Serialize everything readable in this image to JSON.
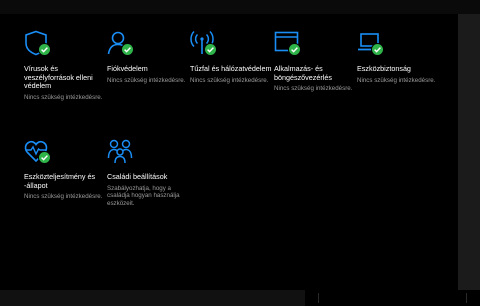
{
  "tiles": [
    {
      "title": "Vírusok és veszélyforrások elleni védelem",
      "status": "Nincs szükség intézkedésre.",
      "icon": "shield-icon"
    },
    {
      "title": "Fiókvédelem",
      "status": "Nincs szükség intézkedésre.",
      "icon": "person-icon"
    },
    {
      "title": "Tűzfal és hálózatvédelem",
      "status": "Nincs szükség intézkedésre.",
      "icon": "antenna-icon"
    },
    {
      "title": "Alkalmazás- és böngészővezérlés",
      "status": "Nincs szükség intézkedésre.",
      "icon": "browser-window-icon"
    },
    {
      "title": "Eszközbiztonság",
      "status": "Nincs szükség intézkedésre.",
      "icon": "laptop-icon"
    },
    {
      "title": "Eszközteljesítmény és -állapot",
      "status": "Nincs szükség intézkedésre.",
      "icon": "heart-pulse-icon"
    },
    {
      "title": "Családi beállítások",
      "status": "Szabályozhatja, hogy a családja hogyan használja eszközeit.",
      "icon": "family-icon"
    }
  ],
  "colors": {
    "accent": "#1a8ef5",
    "ok": "#2fb44a",
    "background": "#000000",
    "muted": "#9a9a9a"
  }
}
